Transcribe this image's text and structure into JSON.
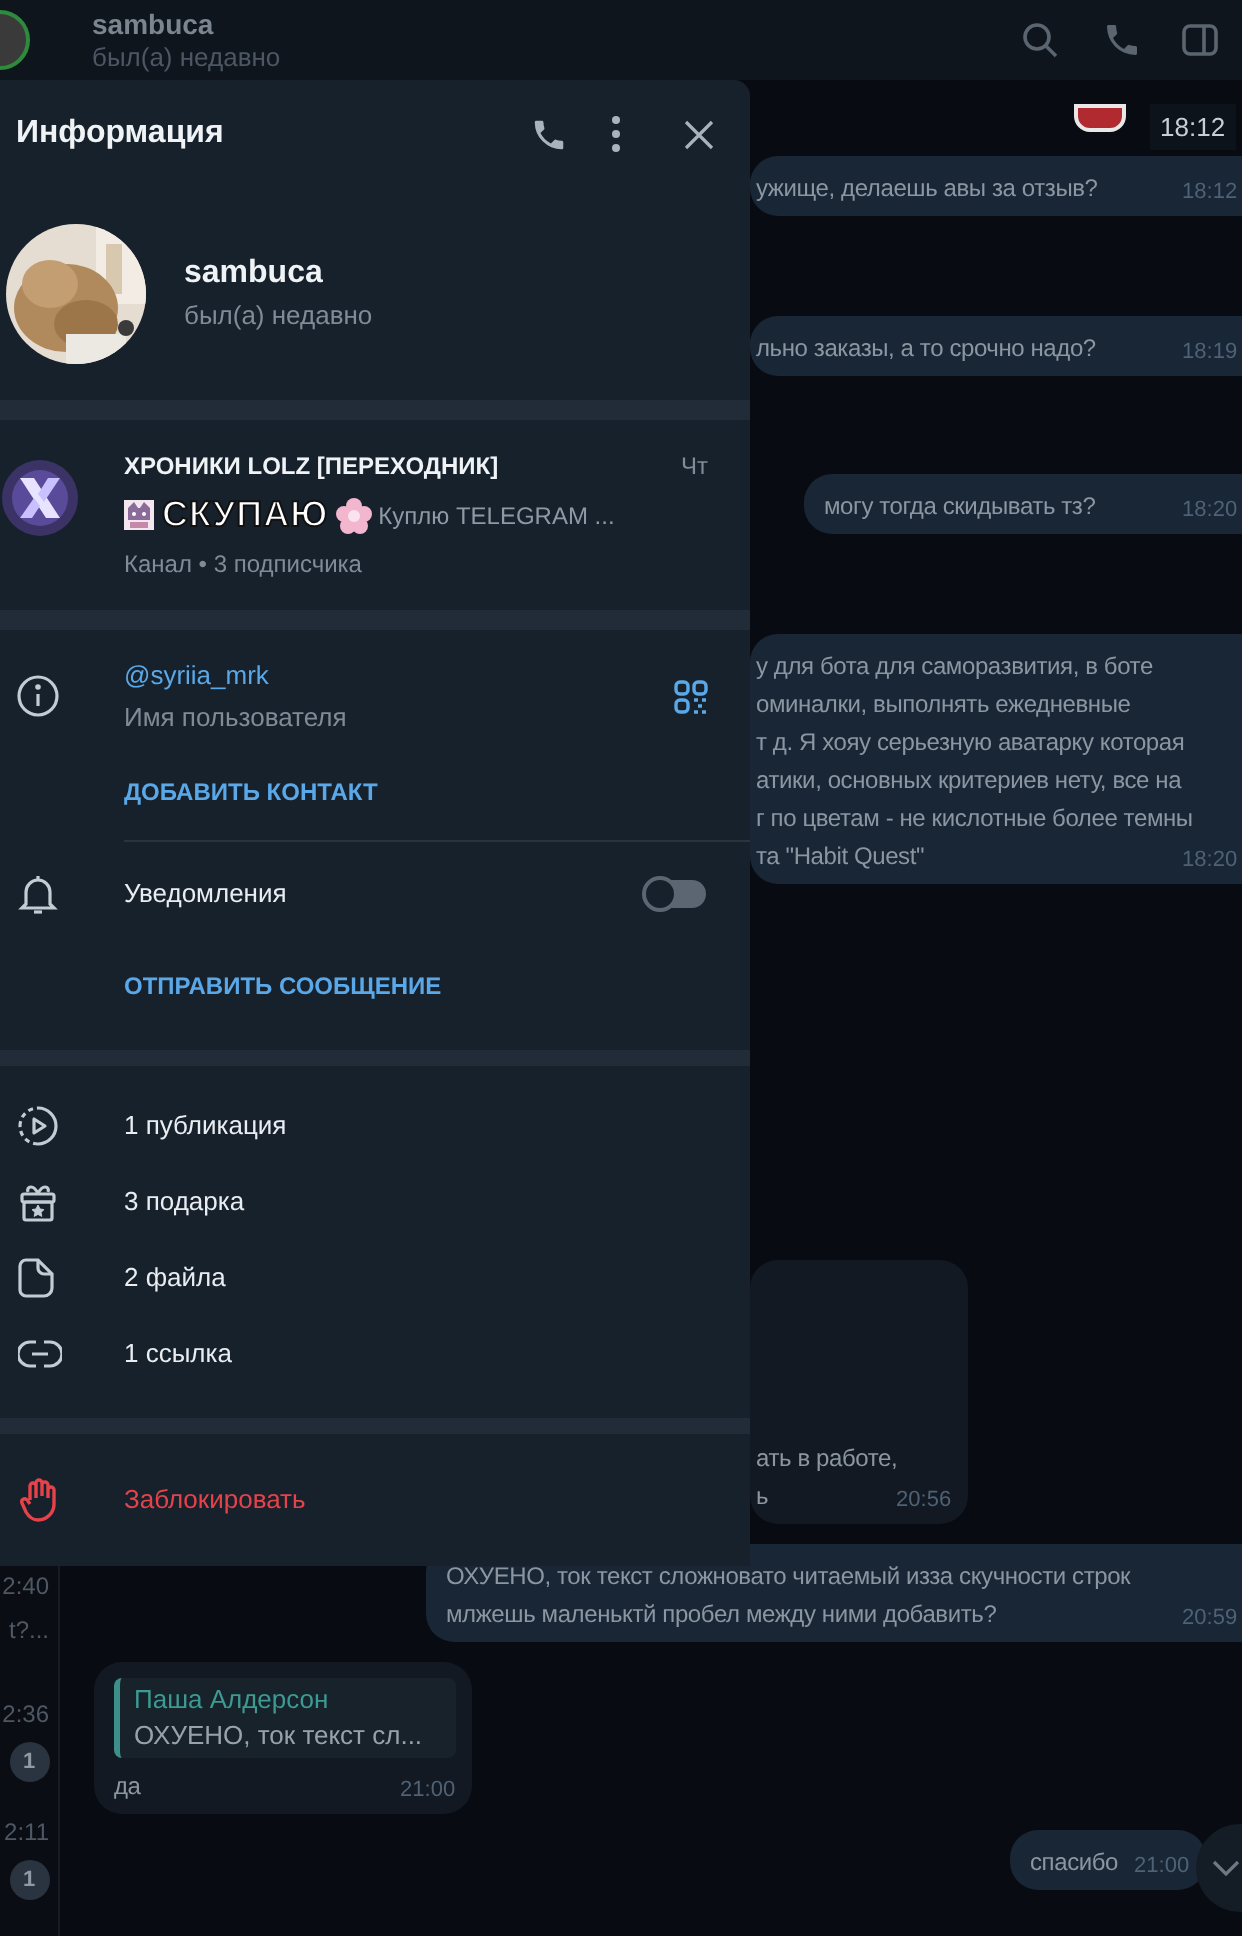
{
  "chat_header": {
    "name": "sambuca",
    "status": "был(а) недавно"
  },
  "chat_list_strip": [
    {
      "kind": "time",
      "text": "2:40"
    },
    {
      "kind": "snippet",
      "text": "t?..."
    },
    {
      "kind": "time",
      "text": "2:36"
    },
    {
      "kind": "badge",
      "text": "1"
    },
    {
      "kind": "time",
      "text": "2:11"
    },
    {
      "kind": "badge",
      "text": "1"
    }
  ],
  "messages": [
    {
      "kind": "sticker",
      "time": "18:12"
    },
    {
      "kind": "outgoing",
      "lines": [
        "ужище, делаешь авы за отзыв?"
      ],
      "time": "18:12"
    },
    {
      "kind": "outgoing",
      "lines": [
        "льно заказы, а то срочно надо?"
      ],
      "time": "18:19"
    },
    {
      "kind": "outgoing",
      "lines": [
        "могу тогда скидывать тз?"
      ],
      "time": "18:20"
    },
    {
      "kind": "outgoing",
      "lines": [
        "у для бота для саморазвития, в боте",
        "оминалки, выполнять ежедневные",
        "т д. Я хояу серьезную аватарку которая",
        "атики, основных критериев нету, все на",
        "г по цветам - не кислотные более темны",
        "та \"Habit Quest\""
      ],
      "time": "18:20"
    },
    {
      "kind": "incoming",
      "lines": [
        "ать в работе,",
        "ь"
      ],
      "time": "20:56"
    },
    {
      "kind": "outgoing",
      "lines": [
        "ОХУЕНО, ток текст сложновато читаемый изза скучности строк",
        "млжешь маленьктй пробел между ними добавить?"
      ],
      "time": "20:59"
    },
    {
      "kind": "incoming",
      "reply": {
        "author": "Паша Алдерсон",
        "text": "ОХУЕНО, ток текст сл..."
      },
      "lines": [
        "да"
      ],
      "time": "21:00"
    },
    {
      "kind": "outgoing",
      "lines": [
        "спасибо"
      ],
      "time": "21:00"
    }
  ],
  "info_panel": {
    "title": "Информация",
    "profile": {
      "name": "sambuca",
      "status": "был(а) недавно"
    },
    "channel": {
      "title": "ХРОНИКИ LOLZ [ПЕРЕХОДНИК]",
      "day": "Чт",
      "preview_title": "СКУПАЮ",
      "preview": "Куплю TELEGRAM ...",
      "meta": "Канал • 3 подписчика"
    },
    "username": {
      "value": "@syriia_mrk",
      "label": "Имя пользователя"
    },
    "add_contact": "ДОБАВИТЬ КОНТАКТ",
    "notifications": {
      "label": "Уведомления",
      "on": false
    },
    "send_message": "ОТПРАВИТЬ СООБЩЕНИЕ",
    "media": [
      {
        "kind": "posts",
        "label": "1 публикация"
      },
      {
        "kind": "gifts",
        "label": "3 подарка"
      },
      {
        "kind": "files",
        "label": "2 файла"
      },
      {
        "kind": "links",
        "label": "1 ссылка"
      }
    ],
    "block": "Заблокировать"
  }
}
